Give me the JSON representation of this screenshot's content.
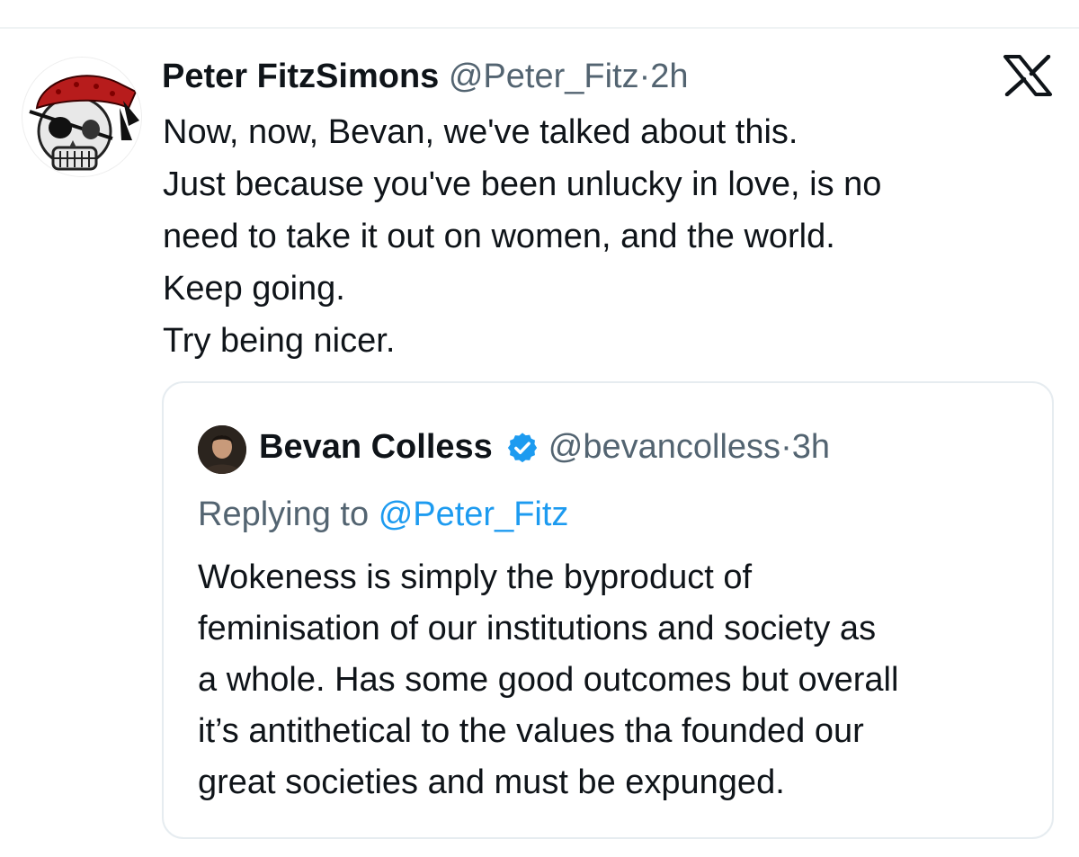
{
  "tweet": {
    "author_name": "Peter FitzSimons",
    "handle": "@Peter_Fitz",
    "separator": "·",
    "time": "2h",
    "body_lines": [
      "Now, now, Bevan, we've talked about this.",
      "Just because you've been unlucky in love, is no",
      "need to take it out on women, and the world.",
      "Keep going.",
      "Try being nicer."
    ],
    "avatar_icon": "pirate-skull-avatar"
  },
  "brand": {
    "logo_icon": "x-logo-icon"
  },
  "quoted_tweet": {
    "author_name": "Bevan Colless",
    "verified": true,
    "handle": "@bevancolless",
    "separator": "·",
    "time": "3h",
    "replying_prefix": "Replying to",
    "replying_to": "@Peter_Fitz",
    "body_lines": [
      "Wokeness is simply the byproduct of",
      "feminisation of our institutions and society as",
      "a whole. Has some good outcomes but overall",
      "it’s antithetical to the values tha founded our",
      "great societies and must be expunged."
    ]
  },
  "colors": {
    "text_primary": "#0f1419",
    "text_secondary": "#536471",
    "link": "#1d9bf0",
    "verified_badge": "#1d9bf0",
    "border": "#e6ecf0"
  }
}
